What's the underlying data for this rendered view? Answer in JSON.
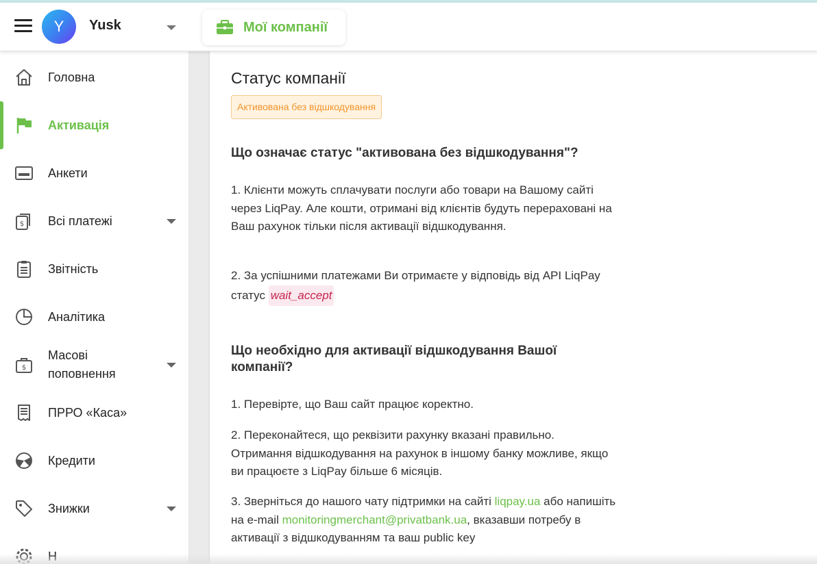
{
  "header": {
    "user_initial": "Y",
    "user_name": "Yusk",
    "companies_label": "Мої компанії"
  },
  "colors": {
    "accent": "#6cc04a",
    "badge_text": "#f0932b",
    "code_text": "#c7254e"
  },
  "sidebar": {
    "items": [
      {
        "label": "Головна",
        "icon": "home-icon"
      },
      {
        "label": "Активація",
        "icon": "flag-icon",
        "active": true
      },
      {
        "label": "Анкети",
        "icon": "card-icon"
      },
      {
        "label": "Всі платежі",
        "icon": "payments-icon",
        "expandable": true
      },
      {
        "label": "Звітність",
        "icon": "clipboard-icon"
      },
      {
        "label": "Аналітика",
        "icon": "pie-chart-icon"
      },
      {
        "label": "Масові поповнення",
        "icon": "wallet-icon",
        "expandable": true
      },
      {
        "label": "ПРРО «Каса»",
        "icon": "receipt-icon"
      },
      {
        "label": "Кредити",
        "icon": "credit-icon"
      },
      {
        "label": "Знижки",
        "icon": "tag-icon",
        "expandable": true
      },
      {
        "label": "Н",
        "icon": "gear-icon"
      }
    ]
  },
  "main": {
    "title": "Статус компанії",
    "status_badge": "Активована без відшкодування",
    "section1_heading": "Що означає статус \"активована без відшкодування\"?",
    "section1_p1": "1. Клієнти можуть сплачувати послуги або товари на Вашому сайті через LiqPay. Але кошти, отримані від клієнтів будуть перераховані на Ваш рахунок тільки після активації відшкодування.",
    "section1_p2_text": "2. За успішними платежами Ви отримаєте у відповідь від API LiqPay статус",
    "section1_p2_code": "wait_accept",
    "section2_heading": "Що необхідно для активації відшкодування Вашої компанії?",
    "section2_p1": "1. Перевірте, що Ваш сайт працює коректно.",
    "section2_p2": "2. Переконайтеся, що реквізити рахунку вказані правильно. Отримання відшкодування на рахунок в іншому банку можливе, якщо ви працюєте з LiqPay більше 6 місяців.",
    "section2_p3_a": "3. Зверніться до нашого чату підтримки на сайті",
    "section2_p3_link1": "liqpay.ua",
    "section2_p3_b": "або напишіть на e-mail",
    "section2_p3_link2": "monitoringmerchant@privatbank.ua",
    "section2_p3_c": ", вказавши потребу в активації з відшкодуванням та ваш public key"
  }
}
